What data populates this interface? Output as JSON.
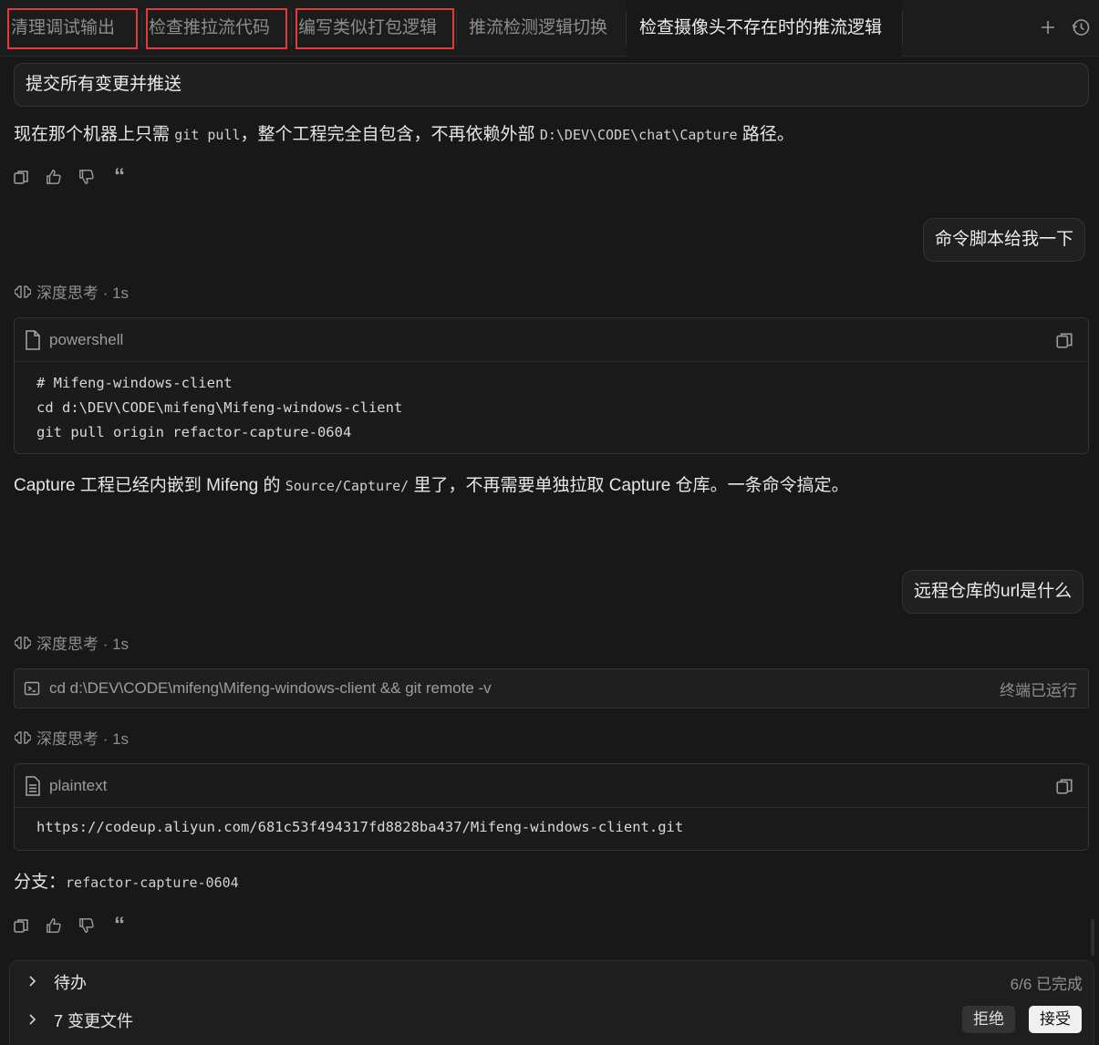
{
  "tabs": [
    {
      "label": "清理调试输出",
      "highlighted": true
    },
    {
      "label": "检查推拉流代码",
      "highlighted": true
    },
    {
      "label": "编写类似打包逻辑",
      "highlighted": true
    },
    {
      "label": "推流检测逻辑切换",
      "highlighted": false
    },
    {
      "label": "检查摄像头不存在时的推流逻辑",
      "active": true
    }
  ],
  "tab_actions": {
    "new_tab_icon": "plus-icon",
    "history_icon": "history-icon"
  },
  "conversation": {
    "prompt_box": "提交所有变更并推送",
    "reply1": {
      "before": "现在那个机器上只需 ",
      "code1": "git pull",
      "middle": "，整个工程完全自包含，不再依赖外部 ",
      "code2": "D:\\DEV\\CODE\\chat\\Capture",
      "after": " 路径。"
    },
    "user_msg1": "命令脚本给我一下",
    "thinking1": "深度思考 · 1s",
    "code_block1": {
      "lang": "powershell",
      "lines": [
        "# Mifeng-windows-client",
        "cd d:\\DEV\\CODE\\mifeng\\Mifeng-windows-client",
        "git pull origin refactor-capture-0604"
      ]
    },
    "reply2": {
      "before": "Capture 工程已经内嵌到 Mifeng 的 ",
      "code": "Source/Capture/",
      "after": " 里了，不再需要单独拉取 Capture 仓库。一条命令搞定。"
    },
    "user_msg2": "远程仓库的url是什么",
    "thinking2": "深度思考 · 1s",
    "terminal": {
      "command": "cd d:\\DEV\\CODE\\mifeng\\Mifeng-windows-client && git remote -v",
      "status": "终端已运行"
    },
    "thinking3": "深度思考 · 1s",
    "code_block2": {
      "lang": "plaintext",
      "lines": [
        "https://codeup.aliyun.com/681c53f494317fd8828ba437/Mifeng-windows-client.git"
      ]
    },
    "reply3": {
      "label": "分支：",
      "code": "refactor-capture-0604"
    }
  },
  "message_actions": [
    "copy-icon",
    "thumbs-up-icon",
    "thumbs-down-icon",
    "quote-icon"
  ],
  "bottom_panel": {
    "todo_label": "待办",
    "todo_status": "6/6 已完成",
    "changed_files_label": "7 变更文件",
    "reject_label": "拒绝",
    "accept_label": "接受"
  }
}
